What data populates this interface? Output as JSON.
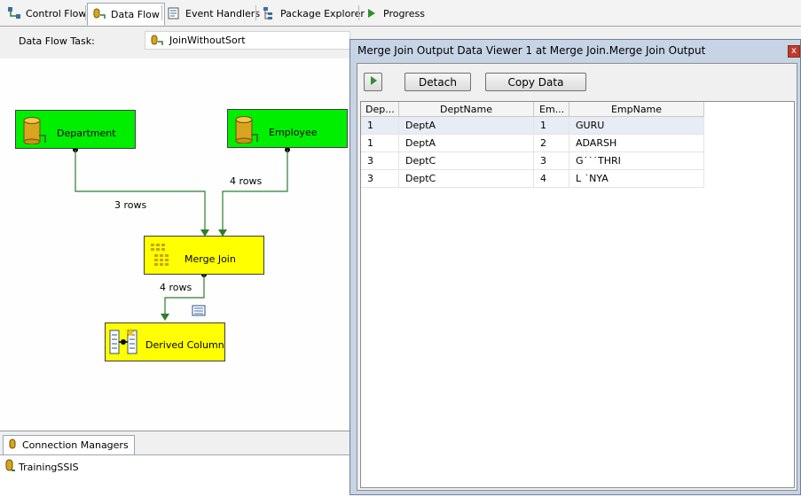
{
  "tabs": [
    {
      "label": "Control Flow",
      "icon": "control-flow-icon",
      "active": false
    },
    {
      "label": "Data Flow",
      "icon": "data-flow-icon",
      "active": true
    },
    {
      "label": "Event Handlers",
      "icon": "event-handlers-icon",
      "active": false
    },
    {
      "label": "Package Explorer",
      "icon": "package-explorer-icon",
      "active": false
    },
    {
      "label": "Progress",
      "icon": "progress-icon",
      "active": false
    }
  ],
  "task": {
    "label": "Data Flow Task:",
    "value": "JoinWithoutSort"
  },
  "components": {
    "department": {
      "label": "Department",
      "color": "#00ee00"
    },
    "employee": {
      "label": "Employee",
      "color": "#00ee00"
    },
    "merge_join": {
      "label": "Merge Join",
      "color": "#ffff00"
    },
    "derived_column": {
      "label": "Derived Column",
      "color": "#ffff00"
    }
  },
  "paths": {
    "department_rows": "3 rows",
    "employee_rows": "4 rows",
    "merge_rows": "4 rows"
  },
  "bottom": {
    "tab_label": "Connection Managers",
    "connection": "TrainingSSIS"
  },
  "viewer": {
    "title": "Merge Join Output Data Viewer 1 at Merge Join.Merge Join Output",
    "close_glyph": "x",
    "buttons": {
      "detach": "Detach",
      "copy": "Copy Data"
    },
    "columns": [
      "Dep...",
      "DeptName",
      "Em...",
      "EmpName"
    ],
    "rows": [
      [
        "1",
        "DeptA",
        "1",
        "GURU"
      ],
      [
        "1",
        "DeptA",
        "2",
        "ADARSH"
      ],
      [
        "3",
        "DeptC",
        "3",
        "G˙˙˙THRI"
      ],
      [
        "3",
        "DeptC",
        "4",
        "L ˙NYA"
      ]
    ]
  }
}
